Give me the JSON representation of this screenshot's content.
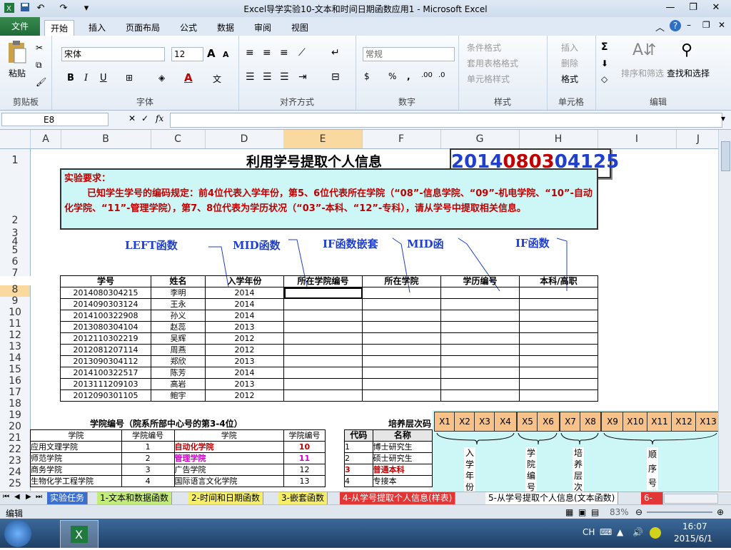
{
  "window": {
    "title": "Excel导学实验10-文本和时间日期函数应用1 - Microsoft Excel"
  },
  "ribbon": {
    "file_tab": "文件",
    "tabs": [
      "开始",
      "插入",
      "页面布局",
      "公式",
      "数据",
      "审阅",
      "视图"
    ],
    "active_tab": "开始",
    "clipboard": {
      "paste": "粘贴",
      "label": "剪贴板"
    },
    "font": {
      "name": "宋体",
      "size": "12",
      "label": "字体",
      "bold": "B",
      "italic": "I",
      "underline": "U",
      "grow": "A",
      "shrink": "A",
      "color_letter": "A"
    },
    "alignment": {
      "label": "对齐方式"
    },
    "number": {
      "format": "常规",
      "label": "数字",
      "percent": "%",
      "comma": ","
    },
    "styles": {
      "cond_format": "条件格式",
      "table_format": "套用表格格式",
      "cell_styles": "单元格样式",
      "label": "样式"
    },
    "cells": {
      "insert": "插入",
      "delete": "删除",
      "format": "格式",
      "label": "单元格"
    },
    "editing": {
      "sort_filter": "排序和筛选",
      "find_select": "查找和选择",
      "label": "编辑",
      "sigma": "Σ"
    }
  },
  "formula_bar": {
    "name_box": "E8",
    "fx": "fx",
    "value": ""
  },
  "columns": [
    "A",
    "B",
    "C",
    "D",
    "E",
    "F",
    "G",
    "H",
    "I",
    "J"
  ],
  "selected_column": "E",
  "rows": [
    "1",
    "2",
    "3",
    "4",
    "5",
    "6",
    "7",
    "8",
    "9",
    "10",
    "11",
    "12",
    "13",
    "14",
    "15",
    "16",
    "17",
    "18",
    "19",
    "20",
    "21",
    "22",
    "23",
    "24",
    "25"
  ],
  "selected_row": "8",
  "sheet": {
    "title": "利用学号提取个人信息",
    "student_id": {
      "part1": "2014",
      "part2": "08",
      "part3": "03",
      "part4": "04125"
    },
    "requirement": {
      "heading": "实验要求：",
      "text": "已知学生学号的编码规定：前4位代表入学年份，第5、6位代表所在学院（“08”-信息学院、“09”-机电学院、“10”-自动化学院、“11”-管理学院），第7、8位代表为学历状况（“03”-本科、“12”-专科），请从学号中提取相关信息。"
    },
    "annotations": [
      "LEFT函数",
      "MID函数",
      "IF函数嵌套",
      "MID函",
      "IF函数"
    ],
    "table_headers": [
      "学号",
      "姓名",
      "入学年份",
      "所在学院编号",
      "所在学院",
      "学历编号",
      "本科/高职"
    ],
    "students": [
      [
        "2014080304215",
        "李明",
        "2014"
      ],
      [
        "2014090303124",
        "王永",
        "2014"
      ],
      [
        "2014100322908",
        "孙义",
        "2014"
      ],
      [
        "2013080304104",
        "赵蕊",
        "2013"
      ],
      [
        "2012110302219",
        "吴辉",
        "2012"
      ],
      [
        "2012081207114",
        "周燕",
        "2012"
      ],
      [
        "2013090304112",
        "郑欣",
        "2013"
      ],
      [
        "2014100322517",
        "陈芳",
        "2014"
      ],
      [
        "2013111209103",
        "高岩",
        "2013"
      ],
      [
        "2012090301105",
        "鲍宇",
        "2012"
      ]
    ],
    "college_table": {
      "title": "学院编号（院系所部中心号的第3-4位）",
      "headers": [
        "学院",
        "学院编号",
        "学院",
        "学院编号"
      ],
      "rows": [
        [
          "应用文理学院",
          "1",
          "自动化学院",
          "10"
        ],
        [
          "师范学院",
          "2",
          "管理学院",
          "11"
        ],
        [
          "商务学院",
          "3",
          "广告学院",
          "12"
        ],
        [
          "生物化学工程学院",
          "4",
          "国际语言文化学院",
          "13"
        ]
      ],
      "highlight_colors": [
        "#c00000",
        "#cc00cc",
        "#000000",
        "#000000"
      ]
    },
    "level_table": {
      "title": "培养层次码",
      "headers": [
        "代码",
        "名称"
      ],
      "rows": [
        [
          "1",
          "博士研究生"
        ],
        [
          "2",
          "硕士研究生"
        ],
        [
          "3",
          "普通本科"
        ],
        [
          "4",
          "专接本"
        ]
      ]
    },
    "digit_labels": [
      "X1",
      "X2",
      "X3",
      "X4",
      "X5",
      "X6",
      "X7",
      "X8",
      "X9",
      "X10",
      "X11",
      "X12",
      "X13"
    ],
    "digit_groups": [
      "入学年份",
      "学院编号",
      "培养层次",
      "顺序号"
    ]
  },
  "sheet_tabs": [
    "实验任务",
    "1-文本和数据函数",
    "2-时间和日期函数",
    "3-嵌套函数",
    "4-从学号提取个人信息(样表)",
    "5-从学号提取个人信息(文本函数)",
    "6-"
  ],
  "active_sheet": "5-从学号提取个人信息(文本函数)",
  "status": {
    "mode": "编辑",
    "zoom": "83%"
  },
  "taskbar": {
    "ime": "CH",
    "time": "16:07",
    "date": "2015/6/1"
  },
  "colors": {
    "accent": "#217346",
    "id_blue": "#1f3fcc",
    "id_red": "#c00000",
    "selection": "#f9d99f"
  }
}
